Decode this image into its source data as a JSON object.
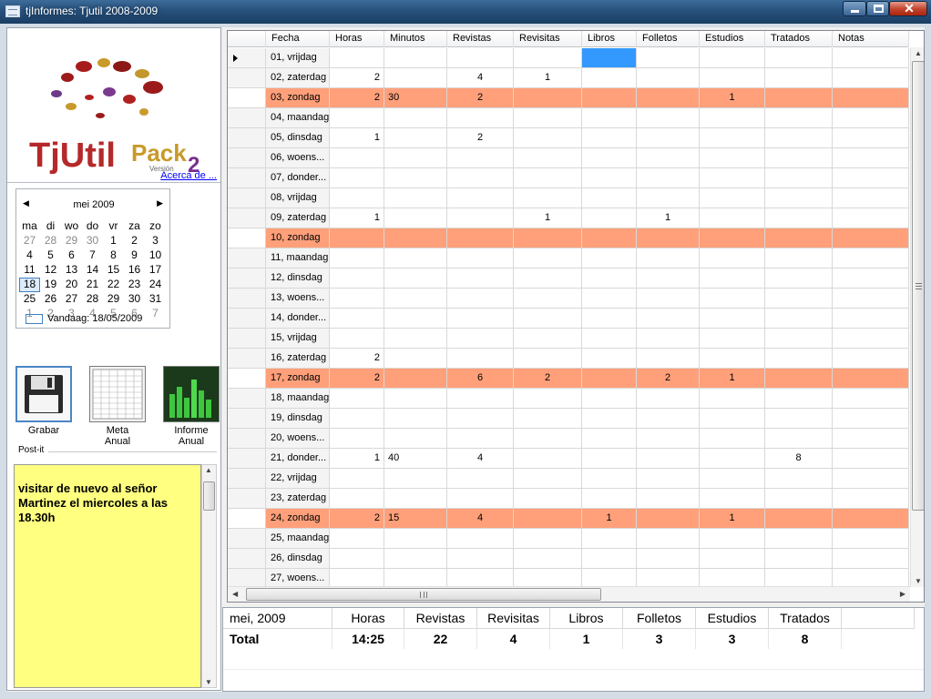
{
  "window": {
    "title": "tjInformes: Tjutil 2008-2009"
  },
  "logo": {
    "text1": "TjUtil",
    "text2": "Pack",
    "version_word": "Versión",
    "version_num": "2"
  },
  "about_link": "Acerca de ...",
  "calendar": {
    "month_label": "mei 2009",
    "weekdays": [
      "ma",
      "di",
      "wo",
      "do",
      "vr",
      "za",
      "zo"
    ],
    "weeks": [
      [
        "27",
        "28",
        "29",
        "30",
        "1",
        "2",
        "3"
      ],
      [
        "4",
        "5",
        "6",
        "7",
        "8",
        "9",
        "10"
      ],
      [
        "11",
        "12",
        "13",
        "14",
        "15",
        "16",
        "17"
      ],
      [
        "18",
        "19",
        "20",
        "21",
        "22",
        "23",
        "24"
      ],
      [
        "25",
        "26",
        "27",
        "28",
        "29",
        "30",
        "31"
      ],
      [
        "1",
        "2",
        "3",
        "4",
        "5",
        "6",
        "7"
      ]
    ],
    "today_label": "Vandaag: 18/05/2009"
  },
  "tools": [
    {
      "label1": "Grabar",
      "label2": ""
    },
    {
      "label1": "Meta",
      "label2": "Anual"
    },
    {
      "label1": "Informe",
      "label2": "Anual"
    }
  ],
  "postit": {
    "label": "Post-it",
    "text": "visitar de nuevo al señor Martinez el miercoles a las 18.30h"
  },
  "grid": {
    "columns": [
      "Fecha",
      "Horas",
      "Minutos",
      "Revistas",
      "Revisitas",
      "Libros",
      "Folletos",
      "Estudios",
      "Tratados",
      "Notas"
    ],
    "rows": [
      {
        "fecha": "01, vrijdag",
        "sunday": false,
        "horas": "",
        "minutos": "",
        "revistas": "",
        "revisitas": "",
        "libros": "",
        "folletos": "",
        "estudios": "",
        "tratados": "",
        "notas": ""
      },
      {
        "fecha": "02, zaterdag",
        "sunday": false,
        "horas": "2",
        "minutos": "",
        "revistas": "4",
        "revisitas": "1",
        "libros": "",
        "folletos": "",
        "estudios": "",
        "tratados": "",
        "notas": ""
      },
      {
        "fecha": "03, zondag",
        "sunday": true,
        "horas": "2",
        "minutos": "30",
        "revistas": "2",
        "revisitas": "",
        "libros": "",
        "folletos": "",
        "estudios": "1",
        "tratados": "",
        "notas": ""
      },
      {
        "fecha": "04, maandag",
        "sunday": false,
        "horas": "",
        "minutos": "",
        "revistas": "",
        "revisitas": "",
        "libros": "",
        "folletos": "",
        "estudios": "",
        "tratados": "",
        "notas": ""
      },
      {
        "fecha": "05, dinsdag",
        "sunday": false,
        "horas": "1",
        "minutos": "",
        "revistas": "2",
        "revisitas": "",
        "libros": "",
        "folletos": "",
        "estudios": "",
        "tratados": "",
        "notas": ""
      },
      {
        "fecha": "06, woens...",
        "sunday": false,
        "horas": "",
        "minutos": "",
        "revistas": "",
        "revisitas": "",
        "libros": "",
        "folletos": "",
        "estudios": "",
        "tratados": "",
        "notas": ""
      },
      {
        "fecha": "07, donder...",
        "sunday": false,
        "horas": "",
        "minutos": "",
        "revistas": "",
        "revisitas": "",
        "libros": "",
        "folletos": "",
        "estudios": "",
        "tratados": "",
        "notas": ""
      },
      {
        "fecha": "08, vrijdag",
        "sunday": false,
        "horas": "",
        "minutos": "",
        "revistas": "",
        "revisitas": "",
        "libros": "",
        "folletos": "",
        "estudios": "",
        "tratados": "",
        "notas": ""
      },
      {
        "fecha": "09, zaterdag",
        "sunday": false,
        "horas": "1",
        "minutos": "",
        "revistas": "",
        "revisitas": "1",
        "libros": "",
        "folletos": "1",
        "estudios": "",
        "tratados": "",
        "notas": ""
      },
      {
        "fecha": "10, zondag",
        "sunday": true,
        "horas": "",
        "minutos": "",
        "revistas": "",
        "revisitas": "",
        "libros": "",
        "folletos": "",
        "estudios": "",
        "tratados": "",
        "notas": ""
      },
      {
        "fecha": "11, maandag",
        "sunday": false,
        "horas": "",
        "minutos": "",
        "revistas": "",
        "revisitas": "",
        "libros": "",
        "folletos": "",
        "estudios": "",
        "tratados": "",
        "notas": ""
      },
      {
        "fecha": "12, dinsdag",
        "sunday": false,
        "horas": "",
        "minutos": "",
        "revistas": "",
        "revisitas": "",
        "libros": "",
        "folletos": "",
        "estudios": "",
        "tratados": "",
        "notas": ""
      },
      {
        "fecha": "13, woens...",
        "sunday": false,
        "horas": "",
        "minutos": "",
        "revistas": "",
        "revisitas": "",
        "libros": "",
        "folletos": "",
        "estudios": "",
        "tratados": "",
        "notas": ""
      },
      {
        "fecha": "14, donder...",
        "sunday": false,
        "horas": "",
        "minutos": "",
        "revistas": "",
        "revisitas": "",
        "libros": "",
        "folletos": "",
        "estudios": "",
        "tratados": "",
        "notas": ""
      },
      {
        "fecha": "15, vrijdag",
        "sunday": false,
        "horas": "",
        "minutos": "",
        "revistas": "",
        "revisitas": "",
        "libros": "",
        "folletos": "",
        "estudios": "",
        "tratados": "",
        "notas": ""
      },
      {
        "fecha": "16, zaterdag",
        "sunday": false,
        "horas": "2",
        "minutos": "",
        "revistas": "",
        "revisitas": "",
        "libros": "",
        "folletos": "",
        "estudios": "",
        "tratados": "",
        "notas": ""
      },
      {
        "fecha": "17, zondag",
        "sunday": true,
        "horas": "2",
        "minutos": "",
        "revistas": "6",
        "revisitas": "2",
        "libros": "",
        "folletos": "2",
        "estudios": "1",
        "tratados": "",
        "notas": ""
      },
      {
        "fecha": "18, maandag",
        "sunday": false,
        "horas": "",
        "minutos": "",
        "revistas": "",
        "revisitas": "",
        "libros": "",
        "folletos": "",
        "estudios": "",
        "tratados": "",
        "notas": ""
      },
      {
        "fecha": "19, dinsdag",
        "sunday": false,
        "horas": "",
        "minutos": "",
        "revistas": "",
        "revisitas": "",
        "libros": "",
        "folletos": "",
        "estudios": "",
        "tratados": "",
        "notas": ""
      },
      {
        "fecha": "20, woens...",
        "sunday": false,
        "horas": "",
        "minutos": "",
        "revistas": "",
        "revisitas": "",
        "libros": "",
        "folletos": "",
        "estudios": "",
        "tratados": "",
        "notas": ""
      },
      {
        "fecha": "21, donder...",
        "sunday": false,
        "horas": "1",
        "minutos": "40",
        "revistas": "4",
        "revisitas": "",
        "libros": "",
        "folletos": "",
        "estudios": "",
        "tratados": "8",
        "notas": ""
      },
      {
        "fecha": "22, vrijdag",
        "sunday": false,
        "horas": "",
        "minutos": "",
        "revistas": "",
        "revisitas": "",
        "libros": "",
        "folletos": "",
        "estudios": "",
        "tratados": "",
        "notas": ""
      },
      {
        "fecha": "23, zaterdag",
        "sunday": false,
        "horas": "",
        "minutos": "",
        "revistas": "",
        "revisitas": "",
        "libros": "",
        "folletos": "",
        "estudios": "",
        "tratados": "",
        "notas": ""
      },
      {
        "fecha": "24, zondag",
        "sunday": true,
        "horas": "2",
        "minutos": "15",
        "revistas": "4",
        "revisitas": "",
        "libros": "1",
        "folletos": "",
        "estudios": "1",
        "tratados": "",
        "notas": ""
      },
      {
        "fecha": "25, maandag",
        "sunday": false,
        "horas": "",
        "minutos": "",
        "revistas": "",
        "revisitas": "",
        "libros": "",
        "folletos": "",
        "estudios": "",
        "tratados": "",
        "notas": ""
      },
      {
        "fecha": "26, dinsdag",
        "sunday": false,
        "horas": "",
        "minutos": "",
        "revistas": "",
        "revisitas": "",
        "libros": "",
        "folletos": "",
        "estudios": "",
        "tratados": "",
        "notas": ""
      },
      {
        "fecha": "27, woens...",
        "sunday": false,
        "horas": "",
        "minutos": "",
        "revistas": "",
        "revisitas": "",
        "libros": "",
        "folletos": "",
        "estudios": "",
        "tratados": "",
        "notas": ""
      }
    ]
  },
  "totals": {
    "headers": [
      "mei, 2009",
      "Horas",
      "Revistas",
      "Revisitas",
      "Libros",
      "Folletos",
      "Estudios",
      "Tratados"
    ],
    "values": [
      "Total",
      "14:25",
      "22",
      "4",
      "1",
      "3",
      "3",
      "8"
    ]
  },
  "colors": {
    "sunday_row": "#ffa07a",
    "postit": "#ffff80",
    "selection": "#3399ff",
    "link": "#0000ff"
  }
}
